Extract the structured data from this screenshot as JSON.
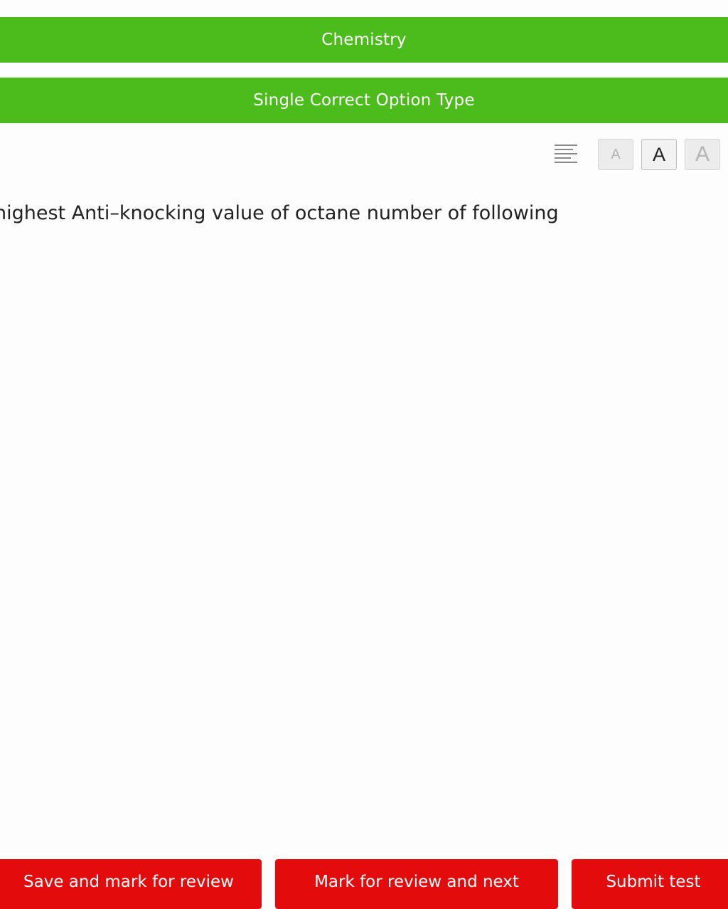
{
  "header": {
    "subject": "Chemistry",
    "question_type": "Single Correct Option Type"
  },
  "toolbar": {
    "align_icon": "text-align-icon",
    "font_small_label": "A",
    "font_medium_label": "A",
    "font_large_label": "A"
  },
  "question": {
    "text": "highest Anti–knocking value of octane number of following"
  },
  "footer": {
    "save_mark_label": "Save and mark for review",
    "mark_next_label": "Mark for review and next",
    "submit_label": "Submit test"
  },
  "colors": {
    "header_bg": "#4cbb1c",
    "button_bg": "#e30b0b"
  }
}
